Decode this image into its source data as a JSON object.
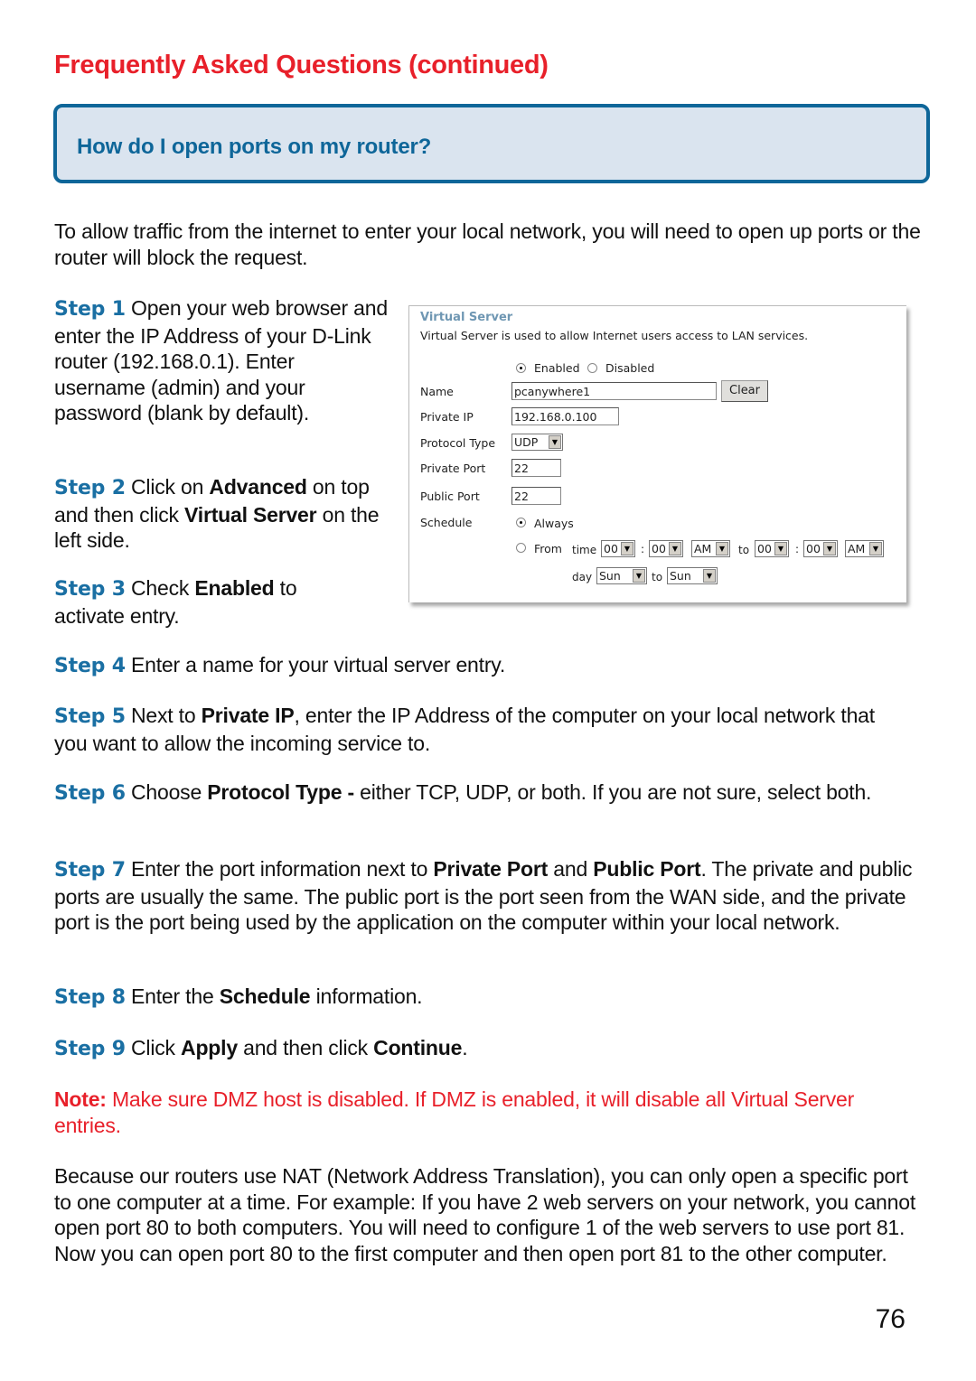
{
  "page": {
    "title": "Frequently Asked Questions (continued)",
    "question": "How do I open ports on my router?",
    "intro": "To allow traffic from the internet to enter your local network, you will need to open up ports or the router will block the request.",
    "page_number": "76"
  },
  "colors": {
    "title_red": "#e8202a",
    "step_blue": "#1a6fa3",
    "box_border": "#0e6699",
    "box_fill": "#dae4ef"
  },
  "steps": [
    {
      "label": "Step 1",
      "parts": [
        {
          "t": " Open your web browser and enter the IP Address of your D-Link router (192.168.0.1). Enter username (admin) and your password (blank by default)."
        }
      ]
    },
    {
      "label": "Step 2",
      "parts": [
        {
          "t": " Click on "
        },
        {
          "b": "Advanced"
        },
        {
          "t": " on top and then click "
        },
        {
          "b": "Virtual Server"
        },
        {
          "t": " on the left side."
        }
      ]
    },
    {
      "label": "Step 3",
      "parts": [
        {
          "t": " Check "
        },
        {
          "b": "Enabled"
        },
        {
          "t": " to activate entry."
        }
      ]
    },
    {
      "label": "Step 4",
      "parts": [
        {
          "t": " Enter a name for your virtual server entry."
        }
      ]
    },
    {
      "label": "Step 5",
      "parts": [
        {
          "t": " Next to "
        },
        {
          "b": "Private IP"
        },
        {
          "t": ", enter the IP Address of the computer on your local network that you want to allow the incoming service to."
        }
      ]
    },
    {
      "label": "Step 6",
      "parts": [
        {
          "t": " Choose "
        },
        {
          "b": "Protocol Type -"
        },
        {
          "t": " either TCP, UDP, or both. If you are not sure, select both."
        }
      ]
    },
    {
      "label": "Step 7",
      "parts": [
        {
          "t": " Enter the port information next to "
        },
        {
          "b": "Private Port"
        },
        {
          "t": " and "
        },
        {
          "b": "Public Port"
        },
        {
          "t": ". The private and public ports are usually the same. The public port is the port seen from the WAN side, and the private port is the port being used by the application on the computer within your local network."
        }
      ]
    },
    {
      "label": "Step 8",
      "parts": [
        {
          "t": " Enter the "
        },
        {
          "b": "Schedule"
        },
        {
          "t": " information."
        }
      ]
    },
    {
      "label": "Step 9",
      "parts": [
        {
          "t": " Click "
        },
        {
          "b": "Apply"
        },
        {
          "t": " and then click "
        },
        {
          "b": "Continue"
        },
        {
          "t": "."
        }
      ]
    }
  ],
  "note": {
    "label": "Note:",
    "text": " Make sure DMZ host is disabled. If DMZ is enabled, it will disable all Virtual Server entries."
  },
  "closing": "Because our routers use NAT (Network Address Translation), you can only open a specific port to one computer at a time. For example: If you have 2 web servers on your network, you cannot open port 80 to both computers. You will need to configure 1 of the web servers to use port 81. Now you can open port 80 to the first computer and then open port 81 to the other computer.",
  "screenshot": {
    "heading": "Virtual Server",
    "description": "Virtual Server is used to allow Internet users access to LAN services.",
    "enabled_label": "Enabled",
    "disabled_label": "Disabled",
    "enabled_selected": true,
    "name_label": "Name",
    "name_value": "pcanywhere1",
    "clear_button": "Clear",
    "private_ip_label": "Private IP",
    "private_ip_value": "192.168.0.100",
    "protocol_label": "Protocol Type",
    "protocol_value": "UDP",
    "private_port_label": "Private Port",
    "private_port_value": "22",
    "public_port_label": "Public Port",
    "public_port_value": "22",
    "schedule_label": "Schedule",
    "always_label": "Always",
    "from_label": "From",
    "time_label": "time",
    "to_label": "to",
    "colon": ":",
    "day_label": "day",
    "start_hour": "00",
    "start_min": "00",
    "start_ampm": "AM",
    "end_hour": "00",
    "end_min": "00",
    "end_ampm": "AM",
    "start_day": "Sun",
    "end_day": "Sun",
    "dropdown_arrow": "▼"
  }
}
